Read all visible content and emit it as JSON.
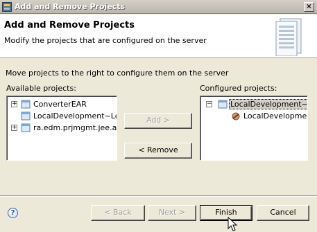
{
  "window": {
    "title": "Add and Remove Projects",
    "close_glyph": "×"
  },
  "header": {
    "title": "Add and Remove Projects",
    "description": "Modify the projects that are configured on the server",
    "icon": "server-banner-icon"
  },
  "instructions": "Move projects to the right to configure them on the server",
  "available": {
    "label": "Available projects:",
    "items": [
      {
        "label": "ConverterEAR",
        "expander": "+",
        "icon": "ear-project-icon"
      },
      {
        "label": "LocalDevelopment~Loca",
        "expander": "",
        "icon": "ear-project-icon"
      },
      {
        "label": "ra.edm.prjmgmt.jee.ap",
        "expander": "+",
        "icon": "ear-project-icon"
      }
    ]
  },
  "configured": {
    "label": "Configured projects:",
    "items": [
      {
        "label": "LocalDevelopment~Loc",
        "expander": "−",
        "icon": "ear-project-icon",
        "selected": true
      },
      {
        "label": "LocalDevelopment~",
        "expander": "",
        "icon": "module-icon",
        "selected": false
      }
    ]
  },
  "buttons": {
    "add": "Add >",
    "remove": "< Remove",
    "back": "< Back",
    "next": "Next >",
    "finish": "Finish",
    "cancel": "Cancel"
  },
  "help_glyph": "?"
}
